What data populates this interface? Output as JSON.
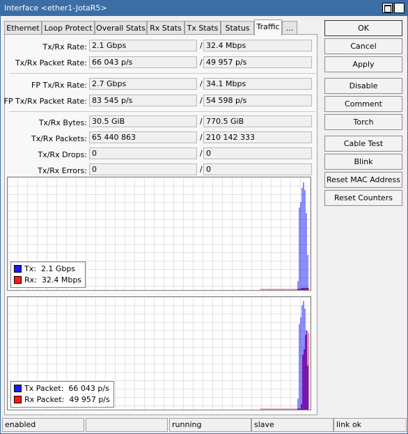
{
  "window": {
    "title": "Interface <ether1-JotaR5>"
  },
  "tabs": [
    "Ethernet",
    "Loop Protect",
    "Overall Stats",
    "Rx Stats",
    "Tx Stats",
    "Status",
    "Traffic",
    "..."
  ],
  "active_tab": "Traffic",
  "stats": {
    "tx_rx_rate": {
      "label": "Tx/Rx Rate:",
      "tx": "2.1 Gbps",
      "rx": "32.4 Mbps"
    },
    "tx_rx_packet_rate": {
      "label": "Tx/Rx Packet Rate:",
      "tx": "66 043 p/s",
      "rx": "49 957 p/s"
    },
    "fp_tx_rx_rate": {
      "label": "FP Tx/Rx Rate:",
      "tx": "2.7 Gbps",
      "rx": "34.1 Mbps"
    },
    "fp_tx_rx_packet_rate": {
      "label": "FP Tx/Rx Packet Rate:",
      "tx": "83 545 p/s",
      "rx": "54 598 p/s"
    },
    "tx_rx_bytes": {
      "label": "Tx/Rx Bytes:",
      "tx": "30.5 GiB",
      "rx": "770.5 GiB"
    },
    "tx_rx_packets": {
      "label": "Tx/Rx Packets:",
      "tx": "65 440 863",
      "rx": "210 142 333"
    },
    "tx_rx_drops": {
      "label": "Tx/Rx Drops:",
      "tx": "0",
      "rx": "0"
    },
    "tx_rx_errors": {
      "label": "Tx/Rx Errors:",
      "tx": "0",
      "rx": "0"
    },
    "slash": "/"
  },
  "graphs": {
    "traffic": {
      "legend": [
        {
          "label": "Tx:",
          "value": "2.1 Gbps",
          "color": "#1a1aff"
        },
        {
          "label": "Rx:",
          "value": "32.4 Mbps",
          "color": "#ff1a1a"
        }
      ],
      "tx_series": [
        0,
        0,
        0,
        0,
        0,
        0,
        0,
        0,
        0,
        0,
        0,
        0,
        0,
        0,
        0,
        0,
        0,
        0,
        0,
        0,
        0,
        0,
        0,
        0,
        0,
        0,
        0,
        0,
        0,
        0,
        0,
        0,
        0,
        0,
        0,
        0,
        0,
        0,
        0,
        0,
        0,
        0,
        0,
        0,
        0,
        0,
        0,
        0,
        0,
        0,
        0,
        0,
        0,
        0,
        0,
        0,
        0,
        0,
        0,
        0,
        0,
        0,
        0,
        0,
        0,
        0,
        0,
        0,
        0,
        0,
        0,
        0,
        0,
        0,
        0,
        0,
        0,
        0,
        0,
        0,
        0,
        0,
        0,
        0,
        0,
        0,
        0,
        0,
        0,
        0,
        0,
        0,
        0,
        0,
        0,
        0,
        0,
        0,
        0,
        0,
        0.08,
        0.75,
        0.8,
        0.93,
        0.98,
        0.91,
        0.7,
        0.32
      ],
      "rx_series": [
        0,
        0,
        0,
        0,
        0,
        0,
        0,
        0,
        0,
        0,
        0,
        0,
        0,
        0,
        0,
        0,
        0,
        0,
        0,
        0,
        0,
        0,
        0,
        0,
        0,
        0,
        0,
        0,
        0,
        0,
        0,
        0,
        0,
        0,
        0,
        0,
        0,
        0,
        0,
        0,
        0,
        0,
        0,
        0,
        0,
        0,
        0,
        0,
        0,
        0,
        0,
        0,
        0,
        0,
        0,
        0,
        0,
        0,
        0,
        0,
        0,
        0,
        0,
        0,
        0,
        0,
        0,
        0,
        0,
        0,
        0,
        0,
        0,
        0.01,
        0.01,
        0.01,
        0.01,
        0.01,
        0.01,
        0.01,
        0.01,
        0.01,
        0.01,
        0.01,
        0.01,
        0.01,
        0.01,
        0.01,
        0.01,
        0.01,
        0.01,
        0.01,
        0.01,
        0.01,
        0.01,
        0.01,
        0.01,
        0.01,
        0.01,
        0.01,
        0.01,
        0.01,
        0.02,
        0.02,
        0.02,
        0.02,
        0.02,
        0.02,
        0.02,
        0.02
      ]
    },
    "packets": {
      "legend": [
        {
          "label": "Tx Packet:",
          "value": "66 043 p/s",
          "color": "#1a1aff"
        },
        {
          "label": "Rx Packet:",
          "value": "49 957 p/s",
          "color": "#ff1a1a"
        }
      ],
      "tx_series": [
        0,
        0,
        0,
        0,
        0,
        0,
        0,
        0,
        0,
        0,
        0,
        0,
        0,
        0,
        0,
        0,
        0,
        0,
        0,
        0,
        0,
        0,
        0,
        0,
        0,
        0,
        0,
        0,
        0,
        0,
        0,
        0,
        0,
        0,
        0,
        0,
        0,
        0,
        0,
        0,
        0,
        0,
        0,
        0,
        0,
        0,
        0,
        0,
        0,
        0,
        0,
        0,
        0,
        0,
        0,
        0,
        0,
        0,
        0,
        0,
        0,
        0,
        0,
        0,
        0,
        0,
        0,
        0,
        0,
        0,
        0,
        0,
        0,
        0,
        0,
        0,
        0,
        0,
        0,
        0,
        0,
        0,
        0,
        0,
        0,
        0,
        0,
        0,
        0,
        0,
        0,
        0,
        0,
        0,
        0,
        0,
        0,
        0,
        0,
        0,
        0.1,
        0.78,
        0.84,
        0.95,
        0.99,
        0.92,
        0.72,
        0.4
      ],
      "rx_series": [
        0,
        0,
        0,
        0,
        0,
        0,
        0,
        0,
        0,
        0,
        0,
        0,
        0,
        0,
        0,
        0,
        0,
        0,
        0,
        0,
        0,
        0,
        0,
        0,
        0,
        0,
        0,
        0,
        0,
        0,
        0,
        0,
        0,
        0,
        0,
        0,
        0,
        0,
        0,
        0,
        0,
        0,
        0,
        0,
        0,
        0,
        0,
        0,
        0,
        0,
        0,
        0,
        0,
        0,
        0,
        0,
        0,
        0,
        0,
        0,
        0,
        0,
        0,
        0,
        0,
        0,
        0,
        0,
        0,
        0,
        0,
        0,
        0,
        0.01,
        0.01,
        0.01,
        0.01,
        0.01,
        0.01,
        0.01,
        0.01,
        0.01,
        0.01,
        0.01,
        0.01,
        0.01,
        0.01,
        0.01,
        0.01,
        0.01,
        0.01,
        0.01,
        0.01,
        0.01,
        0.01,
        0.01,
        0.01,
        0.01,
        0.01,
        0.01,
        0.01,
        0.01,
        0.05,
        0.5,
        0.55,
        0.68,
        0.72,
        0.7,
        0.62,
        0.3
      ]
    }
  },
  "buttons": [
    "OK",
    "Cancel",
    "Apply",
    "Disable",
    "Comment",
    "Torch",
    "Cable Test",
    "Blink",
    "Reset MAC Address",
    "Reset Counters"
  ],
  "statusbar": [
    "enabled",
    "",
    "running",
    "slave",
    "link ok"
  ]
}
